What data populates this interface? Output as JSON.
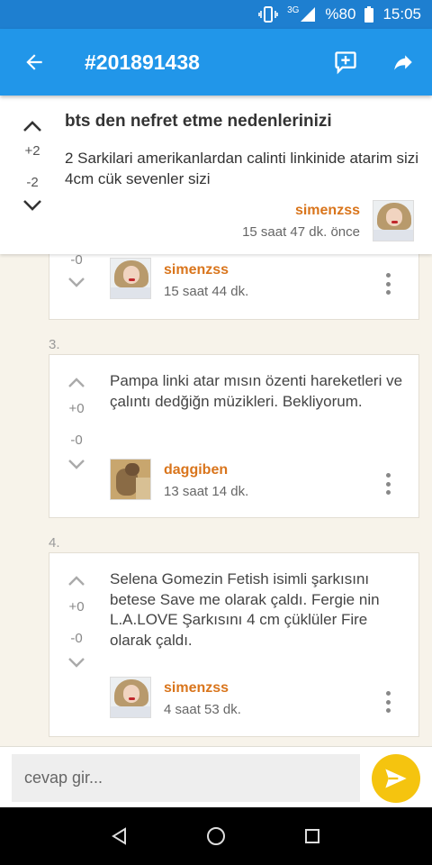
{
  "status_bar": {
    "network": "3G",
    "battery": "%80",
    "time": "15:05"
  },
  "app_bar": {
    "title": "#201891438"
  },
  "post": {
    "title": "bts den nefret etme nedenlerinizi",
    "body": "2 Sarkilari amerikanlardan calinti linkinide atarim sizi 4cm cük sevenler sizi",
    "upvotes": "+2",
    "downvotes": "-2",
    "author": "simenzss",
    "time": "15 saat 47 dk. önce"
  },
  "comments": [
    {
      "number": "",
      "text": "",
      "upvotes": "",
      "downvotes": "-0",
      "author": "simenzss",
      "time": "15 saat 44 dk."
    },
    {
      "number": "3.",
      "text": "Pampa linki atar mısın özenti hareketleri ve çalıntı dedğiğn müzikleri. Bekliyorum.",
      "upvotes": "+0",
      "downvotes": "-0",
      "author": "daggiben",
      "time": "13 saat 14 dk."
    },
    {
      "number": "4.",
      "text": "Selena Gomezin Fetish isimli şarkısını betese Save me olarak çaldı. Fergie nin L.A.LOVE Şarkısını 4 cm çüklüler Fire olarak çaldı.",
      "upvotes": "+0",
      "downvotes": "-0",
      "author": "simenzss",
      "time": "4 saat 53 dk."
    }
  ],
  "reply": {
    "placeholder": "cevap gir..."
  },
  "icons": {
    "back": "arrow-back-icon",
    "comment": "add-comment-icon",
    "share": "share-icon",
    "upvote": "chevron-up-icon",
    "downvote": "chevron-down-icon",
    "more": "more-vert-icon",
    "send": "send-icon",
    "nav_back": "triangle-back-icon",
    "nav_home": "circle-home-icon",
    "nav_recent": "square-recent-icon"
  },
  "colors": {
    "primary": "#2196e9",
    "status": "#1e7fd0",
    "accent": "#f5c40f",
    "author": "#d9751c",
    "background": "#f7f3ea"
  }
}
